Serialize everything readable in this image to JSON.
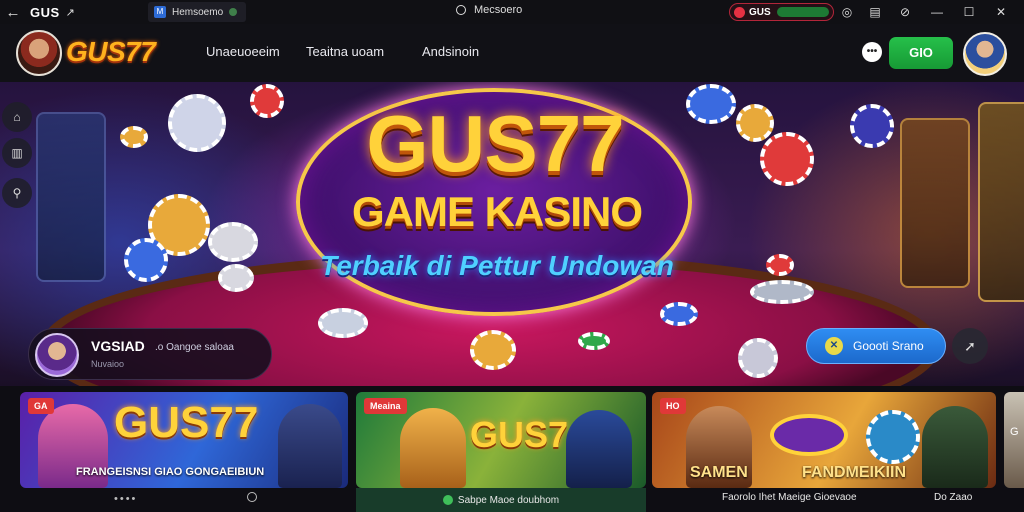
{
  "titlebar": {
    "app_name": "GUS",
    "app_icon": "link-icon",
    "tab_label": "Hemsoemo",
    "center_text": "Mecsoero",
    "live_label": "GUS",
    "live_bar": "",
    "colors": {
      "accent_red": "#e43143",
      "live_green": "#1d7a34"
    }
  },
  "header": {
    "logo_text": "GUS77",
    "nav": [
      "Unaeuoeeim",
      "Teaitna uoam",
      "Andsinoin"
    ],
    "login_label": "GIO",
    "colors": {
      "login": "#22b444",
      "logo": "#ffb21e"
    }
  },
  "hero": {
    "title": "GUS77",
    "subtitle": "GAME KASINO",
    "tagline": "Terbaik di Pettur Undowan",
    "promo": {
      "name": "VGSIAD",
      "desc": ".o Oangoe saloaa",
      "sub": "Nuvaioo"
    },
    "cta_label": "Goooti Srano",
    "side_icons": [
      "home-icon",
      "bank-icon",
      "gift-icon"
    ]
  },
  "cards": [
    {
      "badge": "GA",
      "title": "GUS77",
      "caption": "FRANGEISNSI GIAO GONGAEIBIUN"
    },
    {
      "badge": "Meaina",
      "title": "GUS7",
      "footer": "Sabpe Maoe doubhom"
    },
    {
      "badge": "HO",
      "caption_left": "SAMEN",
      "caption_right": "FANDMEIKIIN",
      "footer": "Faorolo Ihet Maeige Gioevaoe",
      "footer_right": "Do Zaao"
    }
  ],
  "edge_card_text": "G"
}
